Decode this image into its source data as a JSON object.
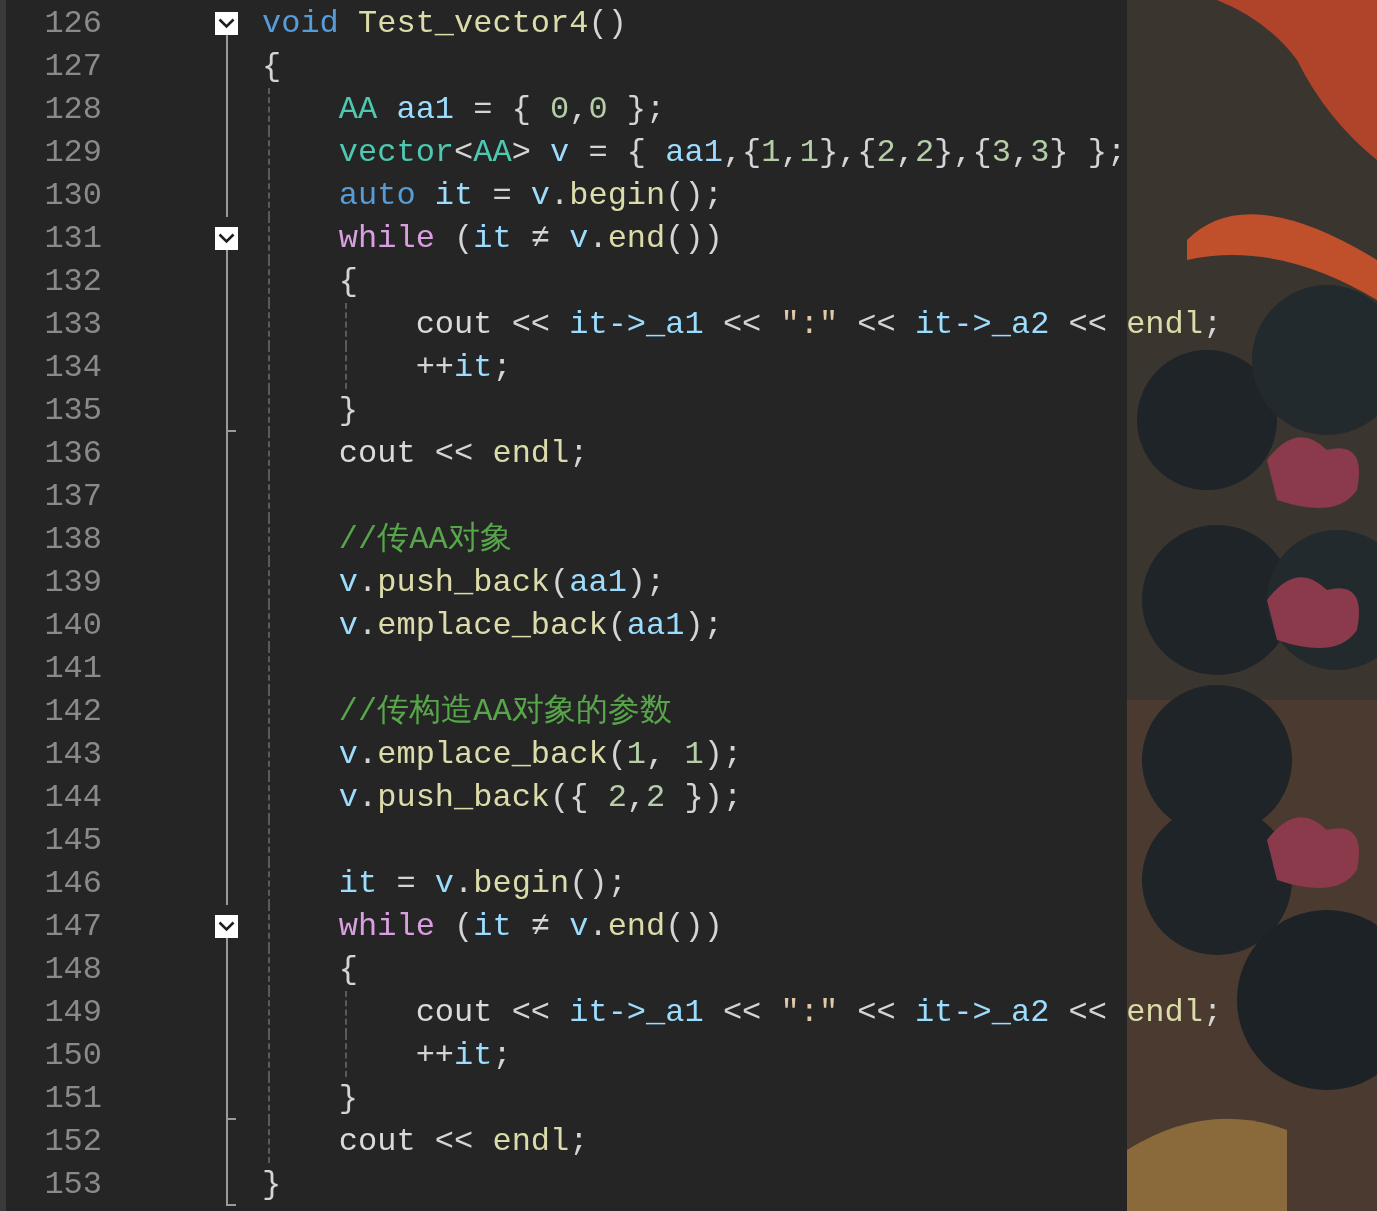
{
  "lines": [
    {
      "number": "126",
      "kind": "fold-start",
      "tokens": [
        {
          "kind": "keyword",
          "text": "void "
        },
        {
          "kind": "function",
          "text": "Test_vector4"
        },
        {
          "kind": "punct",
          "text": "()"
        }
      ]
    },
    {
      "number": "127",
      "kind": "body",
      "tokens": [
        {
          "kind": "punct",
          "text": "{"
        }
      ]
    },
    {
      "number": "128",
      "kind": "body",
      "tokens": [
        {
          "kind": "type",
          "text": "    AA "
        },
        {
          "kind": "variable",
          "text": "aa1"
        },
        {
          "kind": "punct",
          "text": " = { "
        },
        {
          "kind": "number",
          "text": "0"
        },
        {
          "kind": "punct",
          "text": ","
        },
        {
          "kind": "number",
          "text": "0"
        },
        {
          "kind": "punct",
          "text": " };"
        }
      ]
    },
    {
      "number": "129",
      "kind": "body",
      "tokens": [
        {
          "kind": "type",
          "text": "    vector"
        },
        {
          "kind": "punct",
          "text": "<"
        },
        {
          "kind": "type",
          "text": "AA"
        },
        {
          "kind": "punct",
          "text": "> "
        },
        {
          "kind": "variable",
          "text": "v"
        },
        {
          "kind": "punct",
          "text": " = { "
        },
        {
          "kind": "variable",
          "text": "aa1"
        },
        {
          "kind": "punct",
          "text": ",{"
        },
        {
          "kind": "number",
          "text": "1"
        },
        {
          "kind": "punct",
          "text": ","
        },
        {
          "kind": "number",
          "text": "1"
        },
        {
          "kind": "punct",
          "text": "},{"
        },
        {
          "kind": "number",
          "text": "2"
        },
        {
          "kind": "punct",
          "text": ","
        },
        {
          "kind": "number",
          "text": "2"
        },
        {
          "kind": "punct",
          "text": "},{"
        },
        {
          "kind": "number",
          "text": "3"
        },
        {
          "kind": "punct",
          "text": ","
        },
        {
          "kind": "number",
          "text": "3"
        },
        {
          "kind": "punct",
          "text": "} };"
        }
      ]
    },
    {
      "number": "130",
      "kind": "body",
      "tokens": [
        {
          "kind": "keyword",
          "text": "    auto "
        },
        {
          "kind": "variable",
          "text": "it"
        },
        {
          "kind": "punct",
          "text": " = "
        },
        {
          "kind": "variable",
          "text": "v"
        },
        {
          "kind": "punct",
          "text": "."
        },
        {
          "kind": "function",
          "text": "begin"
        },
        {
          "kind": "punct",
          "text": "();"
        }
      ]
    },
    {
      "number": "131",
      "kind": "fold-start",
      "tokens": [
        {
          "kind": "control",
          "text": "    while"
        },
        {
          "kind": "punct",
          "text": " ("
        },
        {
          "kind": "variable",
          "text": "it"
        },
        {
          "kind": "punct",
          "text": " ≠ "
        },
        {
          "kind": "variable",
          "text": "v"
        },
        {
          "kind": "punct",
          "text": "."
        },
        {
          "kind": "function",
          "text": "end"
        },
        {
          "kind": "punct",
          "text": "())"
        }
      ]
    },
    {
      "number": "132",
      "kind": "body",
      "tokens": [
        {
          "kind": "punct",
          "text": "    {"
        }
      ]
    },
    {
      "number": "133",
      "kind": "body",
      "tokens": [
        {
          "kind": "plain",
          "text": "        cout"
        },
        {
          "kind": "punct",
          "text": " << "
        },
        {
          "kind": "variable",
          "text": "it->_a1"
        },
        {
          "kind": "punct",
          "text": " << "
        },
        {
          "kind": "string",
          "text": "\":\""
        },
        {
          "kind": "punct",
          "text": " << "
        },
        {
          "kind": "variable",
          "text": "it->_a2"
        },
        {
          "kind": "punct",
          "text": " << "
        },
        {
          "kind": "function",
          "text": "endl"
        },
        {
          "kind": "punct",
          "text": ";"
        }
      ]
    },
    {
      "number": "134",
      "kind": "body",
      "tokens": [
        {
          "kind": "punct",
          "text": "        ++"
        },
        {
          "kind": "variable",
          "text": "it"
        },
        {
          "kind": "punct",
          "text": ";"
        }
      ]
    },
    {
      "number": "135",
      "kind": "fold-end",
      "tokens": [
        {
          "kind": "punct",
          "text": "    }"
        }
      ]
    },
    {
      "number": "136",
      "kind": "body",
      "tokens": [
        {
          "kind": "plain",
          "text": "    cout"
        },
        {
          "kind": "punct",
          "text": " << "
        },
        {
          "kind": "function",
          "text": "endl"
        },
        {
          "kind": "punct",
          "text": ";"
        }
      ]
    },
    {
      "number": "137",
      "kind": "body"
    },
    {
      "number": "138",
      "kind": "body",
      "tokens": [
        {
          "kind": "comment",
          "text": "    //传AA对象"
        }
      ]
    },
    {
      "number": "139",
      "kind": "body",
      "tokens": [
        {
          "kind": "variable",
          "text": "    v"
        },
        {
          "kind": "punct",
          "text": "."
        },
        {
          "kind": "function",
          "text": "push_back"
        },
        {
          "kind": "punct",
          "text": "("
        },
        {
          "kind": "variable",
          "text": "aa1"
        },
        {
          "kind": "punct",
          "text": ");"
        }
      ]
    },
    {
      "number": "140",
      "kind": "body",
      "tokens": [
        {
          "kind": "variable",
          "text": "    v"
        },
        {
          "kind": "punct",
          "text": "."
        },
        {
          "kind": "function",
          "text": "emplace_back"
        },
        {
          "kind": "punct",
          "text": "("
        },
        {
          "kind": "variable",
          "text": "aa1"
        },
        {
          "kind": "punct",
          "text": ");"
        }
      ]
    },
    {
      "number": "141",
      "kind": "body"
    },
    {
      "number": "142",
      "kind": "body",
      "tokens": [
        {
          "kind": "comment",
          "text": "    //传构造AA对象的参数"
        }
      ]
    },
    {
      "number": "143",
      "kind": "body",
      "tokens": [
        {
          "kind": "variable",
          "text": "    v"
        },
        {
          "kind": "punct",
          "text": "."
        },
        {
          "kind": "function",
          "text": "emplace_back"
        },
        {
          "kind": "punct",
          "text": "("
        },
        {
          "kind": "number",
          "text": "1"
        },
        {
          "kind": "punct",
          "text": ", "
        },
        {
          "kind": "number",
          "text": "1"
        },
        {
          "kind": "punct",
          "text": ");"
        }
      ]
    },
    {
      "number": "144",
      "kind": "body",
      "tokens": [
        {
          "kind": "variable",
          "text": "    v"
        },
        {
          "kind": "punct",
          "text": "."
        },
        {
          "kind": "function",
          "text": "push_back"
        },
        {
          "kind": "punct",
          "text": "({ "
        },
        {
          "kind": "number",
          "text": "2"
        },
        {
          "kind": "punct",
          "text": ","
        },
        {
          "kind": "number",
          "text": "2"
        },
        {
          "kind": "punct",
          "text": " });"
        }
      ]
    },
    {
      "number": "145",
      "kind": "body"
    },
    {
      "number": "146",
      "kind": "body",
      "tokens": [
        {
          "kind": "variable",
          "text": "    it"
        },
        {
          "kind": "punct",
          "text": " = "
        },
        {
          "kind": "variable",
          "text": "v"
        },
        {
          "kind": "punct",
          "text": "."
        },
        {
          "kind": "function",
          "text": "begin"
        },
        {
          "kind": "punct",
          "text": "();"
        }
      ]
    },
    {
      "number": "147",
      "kind": "fold-start",
      "tokens": [
        {
          "kind": "control",
          "text": "    while"
        },
        {
          "kind": "punct",
          "text": " ("
        },
        {
          "kind": "variable",
          "text": "it"
        },
        {
          "kind": "punct",
          "text": " ≠ "
        },
        {
          "kind": "variable",
          "text": "v"
        },
        {
          "kind": "punct",
          "text": "."
        },
        {
          "kind": "function",
          "text": "end"
        },
        {
          "kind": "punct",
          "text": "())"
        }
      ]
    },
    {
      "number": "148",
      "kind": "body",
      "tokens": [
        {
          "kind": "punct",
          "text": "    {"
        }
      ]
    },
    {
      "number": "149",
      "kind": "body",
      "tokens": [
        {
          "kind": "plain",
          "text": "        cout"
        },
        {
          "kind": "punct",
          "text": " << "
        },
        {
          "kind": "variable",
          "text": "it->_a1"
        },
        {
          "kind": "punct",
          "text": " << "
        },
        {
          "kind": "string",
          "text": "\":\""
        },
        {
          "kind": "punct",
          "text": " << "
        },
        {
          "kind": "variable",
          "text": "it->_a2"
        },
        {
          "kind": "punct",
          "text": " << "
        },
        {
          "kind": "function",
          "text": "endl"
        },
        {
          "kind": "punct",
          "text": ";"
        }
      ]
    },
    {
      "number": "150",
      "kind": "body",
      "tokens": [
        {
          "kind": "punct",
          "text": "        ++"
        },
        {
          "kind": "variable",
          "text": "it"
        },
        {
          "kind": "punct",
          "text": ";"
        }
      ]
    },
    {
      "number": "151",
      "kind": "fold-end",
      "tokens": [
        {
          "kind": "punct",
          "text": "    }"
        }
      ]
    },
    {
      "number": "152",
      "kind": "body",
      "tokens": [
        {
          "kind": "plain",
          "text": "    cout"
        },
        {
          "kind": "punct",
          "text": " << "
        },
        {
          "kind": "function",
          "text": "endl"
        },
        {
          "kind": "punct",
          "text": ";"
        }
      ]
    },
    {
      "number": "153",
      "kind": "fold-end",
      "tokens": [
        {
          "kind": "punct",
          "text": "}"
        }
      ]
    }
  ]
}
